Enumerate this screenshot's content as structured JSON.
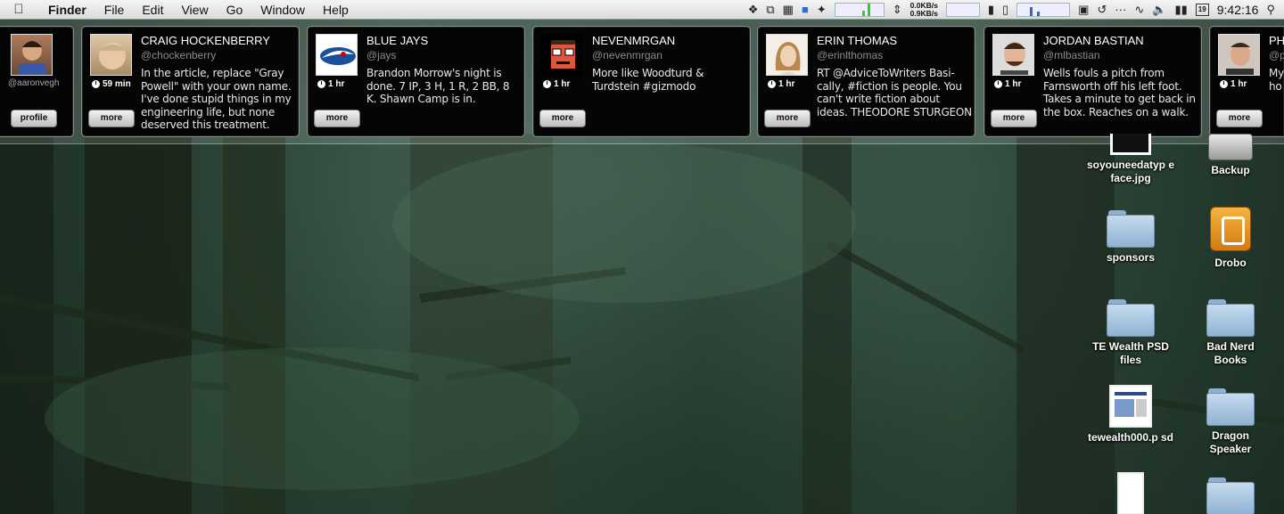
{
  "menubar": {
    "apple_icon": "apple-icon",
    "app_name": "Finder",
    "menus": [
      "File",
      "Edit",
      "View",
      "Go",
      "Window",
      "Help"
    ],
    "net_up": "0.0KB/s",
    "net_down": "0.9KB/s",
    "date_day": "19",
    "time": "9:42:16"
  },
  "profile": {
    "handle": "@aaronvegh",
    "button": "profile"
  },
  "tweets": [
    {
      "name": "CRAIG HOCKENBERRY",
      "handle": "@chockenberry",
      "time": "59 min",
      "text": "In the article, replace \"Gray Powell\" with your own name. I've done stupid things in my engineering life, but none deserved this treatment.",
      "button": "more"
    },
    {
      "name": "BLUE JAYS",
      "handle": "@jays",
      "time": "1 hr",
      "text": "Brandon Morrow's night is done. 7 IP, 3 H, 1 R, 2 BB, 8 K. Shawn Camp is in.",
      "button": "more"
    },
    {
      "name": "NEVENMRGAN",
      "handle": "@nevenmrgan",
      "time": "1 hr",
      "text": "More like Woodturd & Turdstein #gizmodo",
      "button": "more"
    },
    {
      "name": "ERIN THOMAS",
      "handle": "@erinlthomas",
      "time": "1 hr",
      "text": "RT @AdviceToWriters Basi-cally, #fiction is people. You can't write fiction about ideas. THEODORE STURGEON",
      "button": "more"
    },
    {
      "name": "JORDAN BASTIAN",
      "handle": "@mlbastian",
      "time": "1 hr",
      "text": "Wells fouls a pitch from Farnsworth off his left foot. Takes a minute to get back in the box. Reaches on a walk.",
      "button": "more"
    },
    {
      "name": "PH",
      "handle": "@p",
      "time": "1 hr",
      "text": "My ho",
      "button": "more"
    }
  ],
  "desktop": {
    "items": [
      {
        "label": "soyouneedatyp eface.jpg",
        "icon": "image-file-icon"
      },
      {
        "label": "Backup",
        "icon": "drive-icon"
      },
      {
        "label": "sponsors",
        "icon": "folder-icon"
      },
      {
        "label": "Drobo",
        "icon": "drobo-drive-icon"
      },
      {
        "label": "TE Wealth PSD files",
        "icon": "folder-icon"
      },
      {
        "label": "Bad Nerd Books",
        "icon": "folder-icon"
      },
      {
        "label": "tewealth000.p sd",
        "icon": "psd-file-icon"
      },
      {
        "label": "Dragon Speaker",
        "icon": "folder-icon"
      }
    ]
  }
}
